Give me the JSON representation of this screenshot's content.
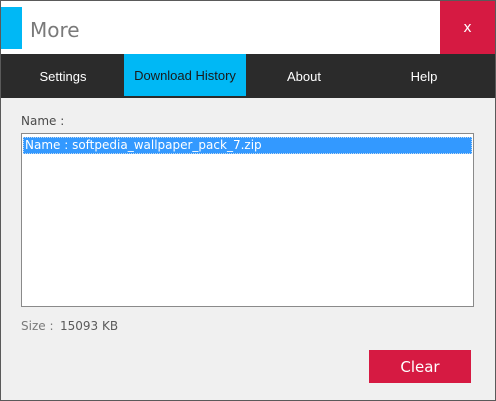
{
  "window": {
    "title": "More",
    "close_label": "x"
  },
  "nav": {
    "items": [
      {
        "label": "Settings"
      },
      {
        "label": "Download History",
        "active": true
      },
      {
        "label": "About"
      },
      {
        "label": "Help"
      }
    ]
  },
  "content": {
    "name_label": "Name :",
    "list_items": [
      "Name : softpedia_wallpaper_pack_7.zip"
    ],
    "size_label": "Size :",
    "size_value": "15093 KB",
    "clear_label": "Clear"
  },
  "colors": {
    "accent": "#00b8f5",
    "danger": "#d61a42",
    "nav_bg": "#2b2b2b",
    "selection": "#3399ff"
  }
}
